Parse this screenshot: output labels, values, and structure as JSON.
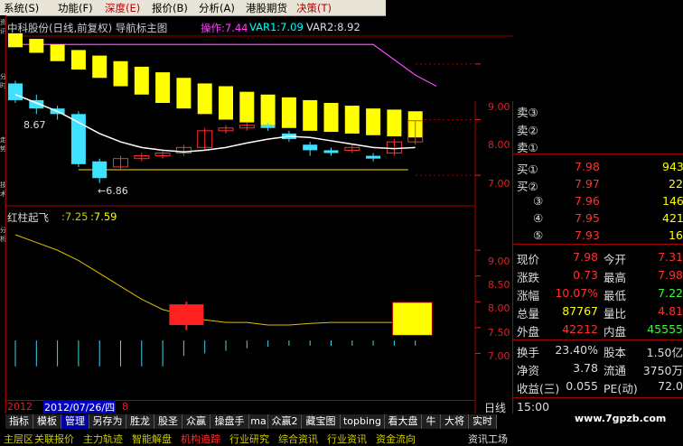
{
  "menu": [
    "系统(S)",
    "功能(F)",
    "深度(E)",
    "报价(B)",
    "分析(A)",
    "港股期货",
    "决策(T)"
  ],
  "top_chart": {
    "title": "中科股份(日线,前复权) 导航标主图",
    "op_label": "操作:7.44",
    "var1_label": "VAR1:7.09",
    "var2_label": "VAR2:8.92",
    "high_mark": "8.67",
    "low_mark": "←6.86",
    "y_ticks": [
      "9.00",
      "8.00",
      "7.00"
    ],
    "y_values": [
      9.0,
      8.0,
      7.0
    ],
    "y_range": [
      6.5,
      9.5
    ],
    "colors": {
      "op": "#ff40ff",
      "var1": "#00ffff",
      "var2": "#dddddd",
      "bar": "#ffff00",
      "up": "#ff3030",
      "down": "#40e0ff",
      "ma": "#ffffff",
      "support": "#d4b000"
    },
    "yellow_blocks": [
      {
        "hi": 9.55,
        "lo": 9.3
      },
      {
        "hi": 9.45,
        "lo": 9.2
      },
      {
        "hi": 9.35,
        "lo": 9.05
      },
      {
        "hi": 9.25,
        "lo": 8.9
      },
      {
        "hi": 9.15,
        "lo": 8.75
      },
      {
        "hi": 9.05,
        "lo": 8.6
      },
      {
        "hi": 8.95,
        "lo": 8.45
      },
      {
        "hi": 8.85,
        "lo": 8.3
      },
      {
        "hi": 8.75,
        "lo": 8.2
      },
      {
        "hi": 8.65,
        "lo": 8.1
      },
      {
        "hi": 8.6,
        "lo": 8.0
      },
      {
        "hi": 8.5,
        "lo": 7.95
      },
      {
        "hi": 8.45,
        "lo": 7.9
      },
      {
        "hi": 8.4,
        "lo": 7.85
      },
      {
        "hi": 8.35,
        "lo": 7.8
      },
      {
        "hi": 8.3,
        "lo": 7.78
      },
      {
        "hi": 8.25,
        "lo": 7.75
      },
      {
        "hi": 8.2,
        "lo": 7.72
      },
      {
        "hi": 8.18,
        "lo": 7.7
      },
      {
        "hi": 8.15,
        "lo": 7.68
      }
    ],
    "candles": [
      {
        "o": 8.65,
        "c": 8.35,
        "h": 8.7,
        "l": 8.3
      },
      {
        "o": 8.35,
        "c": 8.2,
        "h": 8.45,
        "l": 8.1
      },
      {
        "o": 8.2,
        "c": 8.1,
        "h": 8.25,
        "l": 8.0
      },
      {
        "o": 8.1,
        "c": 7.2,
        "h": 8.15,
        "l": 7.15
      },
      {
        "o": 7.25,
        "c": 6.95,
        "h": 7.3,
        "l": 6.86
      },
      {
        "o": 7.15,
        "c": 7.3,
        "h": 7.35,
        "l": 7.1
      },
      {
        "o": 7.3,
        "c": 7.35,
        "h": 7.4,
        "l": 7.25
      },
      {
        "o": 7.35,
        "c": 7.4,
        "h": 7.45,
        "l": 7.3
      },
      {
        "o": 7.4,
        "c": 7.5,
        "h": 7.55,
        "l": 7.35
      },
      {
        "o": 7.5,
        "c": 7.8,
        "h": 7.85,
        "l": 7.45
      },
      {
        "o": 7.8,
        "c": 7.85,
        "h": 7.9,
        "l": 7.75
      },
      {
        "o": 7.85,
        "c": 7.9,
        "h": 7.95,
        "l": 7.8
      },
      {
        "o": 7.9,
        "c": 7.85,
        "h": 7.95,
        "l": 7.8
      },
      {
        "o": 7.75,
        "c": 7.65,
        "h": 7.8,
        "l": 7.6
      },
      {
        "o": 7.55,
        "c": 7.45,
        "h": 7.6,
        "l": 7.35
      },
      {
        "o": 7.45,
        "c": 7.4,
        "h": 7.5,
        "l": 7.35
      },
      {
        "o": 7.45,
        "c": 7.5,
        "h": 7.55,
        "l": 7.4
      },
      {
        "o": 7.35,
        "c": 7.3,
        "h": 7.4,
        "l": 7.25
      },
      {
        "o": 7.4,
        "c": 7.6,
        "h": 7.65,
        "l": 7.35
      },
      {
        "o": 7.6,
        "c": 7.98,
        "h": 7.98,
        "l": 7.55
      }
    ],
    "ma": [
      8.45,
      8.3,
      8.15,
      7.95,
      7.75,
      7.6,
      7.5,
      7.45,
      7.42,
      7.45,
      7.5,
      7.58,
      7.65,
      7.7,
      7.68,
      7.62,
      7.56,
      7.5,
      7.48,
      7.5
    ],
    "support": 7.1,
    "op_line": [
      {
        "x": 0,
        "v": 9.35
      },
      {
        "x": 17,
        "v": 9.35
      },
      {
        "x": 19,
        "v": 8.8
      },
      {
        "x": 20,
        "v": 8.6
      }
    ]
  },
  "bottom_chart": {
    "title_lbl": "红柱起飞",
    "v1": ":7.25",
    "v2": ":7.59",
    "y_ticks": [
      "9.00",
      "8.50",
      "8.00",
      "7.50",
      "7.00"
    ],
    "y_values": [
      9.0,
      8.5,
      8.0,
      7.5,
      7.0
    ],
    "y_range": [
      6.5,
      9.3
    ],
    "curve": [
      9.3,
      9.15,
      9.0,
      8.8,
      8.55,
      8.3,
      8.05,
      7.85,
      7.75,
      7.65,
      7.6,
      7.6,
      7.55,
      7.55,
      7.58,
      7.6,
      7.6,
      7.6,
      7.6,
      7.6
    ],
    "red_block": {
      "idx": 8,
      "hi": 7.95,
      "lo": 7.55,
      "wick_hi": 8.0,
      "wick_lo": 7.45
    },
    "yellow_block": {
      "idx": 18,
      "hi": 7.99,
      "lo": 7.35
    },
    "spikes": [
      7.25,
      7.25,
      7.25,
      7.25,
      7.25,
      7.25,
      7.25,
      7.25,
      7.25,
      7.25,
      7.25,
      7.25,
      7.25,
      7.25,
      7.25,
      7.25,
      7.25,
      7.25,
      7.25,
      7.25
    ],
    "spike_base": 7.25,
    "spike_len": [
      0.5,
      0.5,
      0.5,
      0.5,
      0.5,
      0.5,
      0.5,
      0.5,
      0.3,
      0.25,
      0.2,
      0.15,
      0.12,
      0.1,
      0.1,
      0.1,
      0.1,
      0.1,
      0.1,
      0.1
    ]
  },
  "date_bar": {
    "d1": "2012",
    "d2": "2012/07/26/四",
    "d3": "8",
    "period": "日线"
  },
  "right_panel": {
    "sells": [
      {
        "label": "卖③",
        "price": "",
        "vol": ""
      },
      {
        "label": "卖②",
        "price": "",
        "vol": ""
      },
      {
        "label": "卖①",
        "price": "",
        "vol": ""
      }
    ],
    "buys": [
      {
        "label": "买①",
        "price": "7.98",
        "vol": "943"
      },
      {
        "label": "买②",
        "price": "7.97",
        "vol": "22"
      },
      {
        "label": "③",
        "price": "7.96",
        "vol": "146"
      },
      {
        "label": "④",
        "price": "7.95",
        "vol": "421"
      },
      {
        "label": "⑤",
        "price": "7.93",
        "vol": "16"
      }
    ],
    "stats": [
      {
        "k1": "现价",
        "v1": "7.98",
        "k2": "今开",
        "v2": "7.31",
        "c1": "#ff3030",
        "c2": "#ff3030"
      },
      {
        "k1": "涨跌",
        "v1": "0.73",
        "k2": "最高",
        "v2": "7.98",
        "c1": "#ff3030",
        "c2": "#ff3030"
      },
      {
        "k1": "涨幅",
        "v1": "10.07%",
        "k2": "最低",
        "v2": "7.22",
        "c1": "#ff3030",
        "c2": "#30ff30"
      },
      {
        "k1": "总量",
        "v1": "87767",
        "k2": "量比",
        "v2": "4.81",
        "c1": "#ffff00",
        "c2": "#ff3030"
      },
      {
        "k1": "外盘",
        "v1": "42212",
        "k2": "内盘",
        "v2": "45555",
        "c1": "#ff3030",
        "c2": "#30ff30"
      }
    ],
    "stats2": [
      {
        "k1": "换手",
        "v1": "23.40%",
        "k2": "股本",
        "v2": "1.50亿"
      },
      {
        "k1": "净资",
        "v1": "3.78",
        "k2": "流通",
        "v2": "3750万"
      },
      {
        "k1": "收益(三)",
        "v1": "0.055",
        "k2": "PE(动)",
        "v2": "72.0"
      }
    ],
    "time": "15:00",
    "website": "www.7gpzb.com"
  },
  "tabs": [
    "指标",
    "模板",
    "管理",
    "另存为",
    "胜龙",
    "股圣",
    "众赢",
    "操盘手",
    "ma",
    "众赢2",
    "藏宝图",
    "topbing",
    "看大盘",
    "牛",
    "大将",
    "实时"
  ],
  "active_tab": "管理",
  "bottom_links": [
    "主层区",
    "关联报价",
    "主力轨迹",
    "智能解盘",
    "机构追踪",
    "行业研究",
    "综合资讯",
    "行业资讯",
    "资金流向",
    "资讯工场"
  ],
  "side_labels": [
    "资讯",
    "分时",
    "走势",
    "技术",
    "分析"
  ]
}
